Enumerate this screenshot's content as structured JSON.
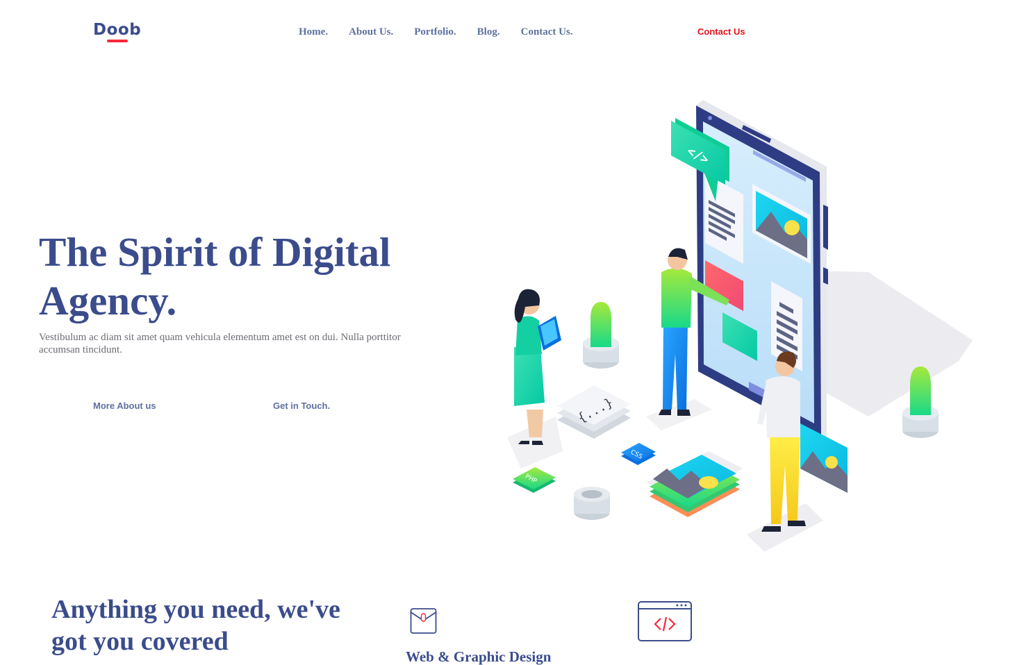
{
  "header": {
    "logo": "Doob",
    "nav": [
      "Home.",
      "About Us.",
      "Portfolio.",
      "Blog.",
      "Contact Us."
    ],
    "cta": "Contact Us"
  },
  "hero": {
    "title": "The Spirit of Digital Agency.",
    "text": "Vestibulum ac diam sit amet quam vehicula elementum amet est on dui. Nulla porttitor accumsan tincidunt.",
    "btn_about": "More About us",
    "btn_touch": "Get in Touch.",
    "illustration_labels": {
      "css": "CSS",
      "php": "PHP",
      "code": "</>",
      "braces": "{...}"
    }
  },
  "services": {
    "title": "Anything you need, we've got you covered",
    "items": [
      "Web & Graphic Design"
    ]
  },
  "colors": {
    "brand": "#3b4c8c",
    "accent_red": "#f8283b",
    "nav": "#60719f",
    "cta": "#e8101a"
  }
}
